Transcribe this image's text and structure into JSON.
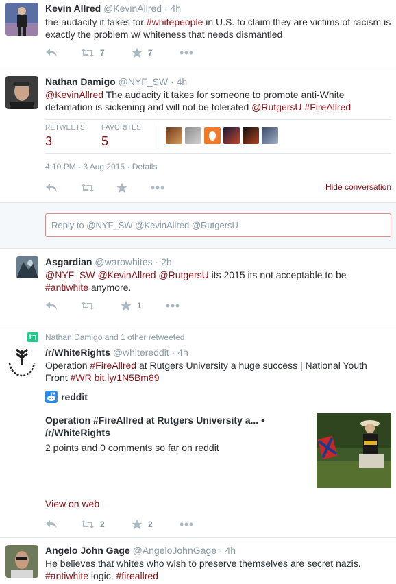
{
  "tweets": [
    {
      "name": "Kevin Allred",
      "handle": "@KevinAllred",
      "time": "4h",
      "text_parts": [
        {
          "t": "the audacity it takes for ",
          "cls": ""
        },
        {
          "t": "#whitepeople",
          "cls": "hashtag"
        },
        {
          "t": " in U.S. to claim they are victims of racism is exactly the problem w/ whiteness that needs dismantled",
          "cls": ""
        }
      ],
      "retweet_count": "7",
      "favorite_count": "7"
    },
    {
      "name": "Nathan Damigo",
      "handle": "@NYF_SW",
      "time": "4h",
      "text_parts": [
        {
          "t": "@KevinAllred",
          "cls": "link"
        },
        {
          "t": " The audacity it takes for someone to promote anti-White defamation is sickening and will not be tolerated ",
          "cls": ""
        },
        {
          "t": "@RutgersU",
          "cls": "link"
        },
        {
          "t": " ",
          "cls": ""
        },
        {
          "t": "#FireAllred",
          "cls": "hashtag"
        }
      ],
      "retweets_label": "RETWEETS",
      "retweets_value": "3",
      "favorites_label": "FAVORITES",
      "favorites_value": "5",
      "timestamp": "4:10 PM - 3 Aug 2015",
      "details": "Details",
      "hide_conversation": "Hide conversation",
      "reply_placeholder": "Reply to @NYF_SW @KevinAllred @RutgersU"
    },
    {
      "name": "Asgardian",
      "handle": "@warowhites",
      "time": "2h",
      "text_parts": [
        {
          "t": "@NYF_SW",
          "cls": "link"
        },
        {
          "t": " ",
          "cls": ""
        },
        {
          "t": "@KevinAllred",
          "cls": "link"
        },
        {
          "t": " ",
          "cls": ""
        },
        {
          "t": "@RutgersU",
          "cls": "link"
        },
        {
          "t": " its 2015 its not acceptable to be ",
          "cls": ""
        },
        {
          "t": "#antiwhite",
          "cls": "hashtag"
        },
        {
          "t": " anymore.",
          "cls": ""
        }
      ],
      "favorite_count": "1"
    },
    {
      "retweeted_by": "Nathan Damigo and 1 other retweeted",
      "name": "/r/WhiteRights",
      "handle": "@whitereddit",
      "time": "4h",
      "text_parts": [
        {
          "t": "Operation ",
          "cls": ""
        },
        {
          "t": "#FireAllred",
          "cls": "hashtag"
        },
        {
          "t": " at Rutgers University a huge success | National Youth Front ",
          "cls": ""
        },
        {
          "t": "#WR",
          "cls": "hashtag"
        },
        {
          "t": " ",
          "cls": ""
        },
        {
          "t": "bit.ly/1N5Bm89",
          "cls": "link"
        }
      ],
      "card_source": "reddit",
      "card_title": "Operation #FireAllred at Rutgers University a... • /r/WhiteRights",
      "card_desc": "2 points and 0 comments so far on reddit",
      "view_on_web": "View on web",
      "retweet_count": "2",
      "favorite_count": "2"
    },
    {
      "name": "Angelo John Gage",
      "handle": "@AngeloJohnGage",
      "time": "4h",
      "text_parts": [
        {
          "t": "He believes that whites who wish to preserve themselves are secret nazis. ",
          "cls": ""
        },
        {
          "t": "#antiwhite",
          "cls": "hashtag"
        },
        {
          "t": " logic. ",
          "cls": ""
        },
        {
          "t": "#fireallred",
          "cls": "hashtag"
        }
      ]
    }
  ],
  "colors": {
    "link": "#8b0e13",
    "muted": "#8899a6",
    "border": "#e1e8ed",
    "reply_border": "#e08a8a"
  }
}
